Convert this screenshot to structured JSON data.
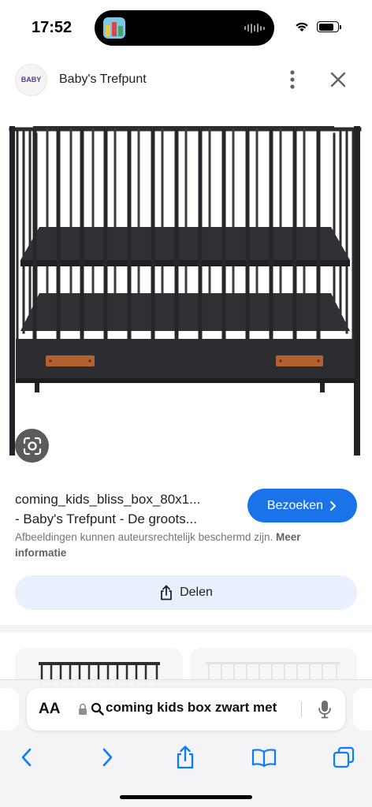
{
  "status_bar": {
    "time": "17:52",
    "battery_level": 0.8
  },
  "header": {
    "site_name": "Baby's Trefpunt",
    "logo_text": "BABY"
  },
  "result": {
    "title_line1": "coming_kids_bliss_box_80x1...",
    "title_line2": "- Baby's Trefpunt - De groots...",
    "visit_label": "Bezoeken",
    "copyright_text": "Afbeeldingen kunnen auteursrechtelijk beschermd zijn.",
    "more_info_label": "Meer informatie",
    "share_label": "Delen"
  },
  "address_bar": {
    "aa_label": "AA",
    "query": "coming kids box zwart met"
  },
  "icons": {
    "more": "more-vertical-icon",
    "close": "close-icon",
    "lens": "lens-icon",
    "visit": "chevron-right-icon",
    "share": "share-icon",
    "lock": "lock-icon",
    "search": "search-icon",
    "mic": "microphone-icon",
    "back": "back-icon",
    "forward": "forward-icon",
    "toolbar_share": "share-icon",
    "bookmarks": "bookmarks-icon",
    "tabs": "tabs-icon"
  },
  "colors": {
    "accent": "#1a73e8",
    "safari_blue": "#0a7aff",
    "share_bg": "#e8f0fe",
    "playpen": "#2b2d30",
    "handle": "#b5602f"
  }
}
